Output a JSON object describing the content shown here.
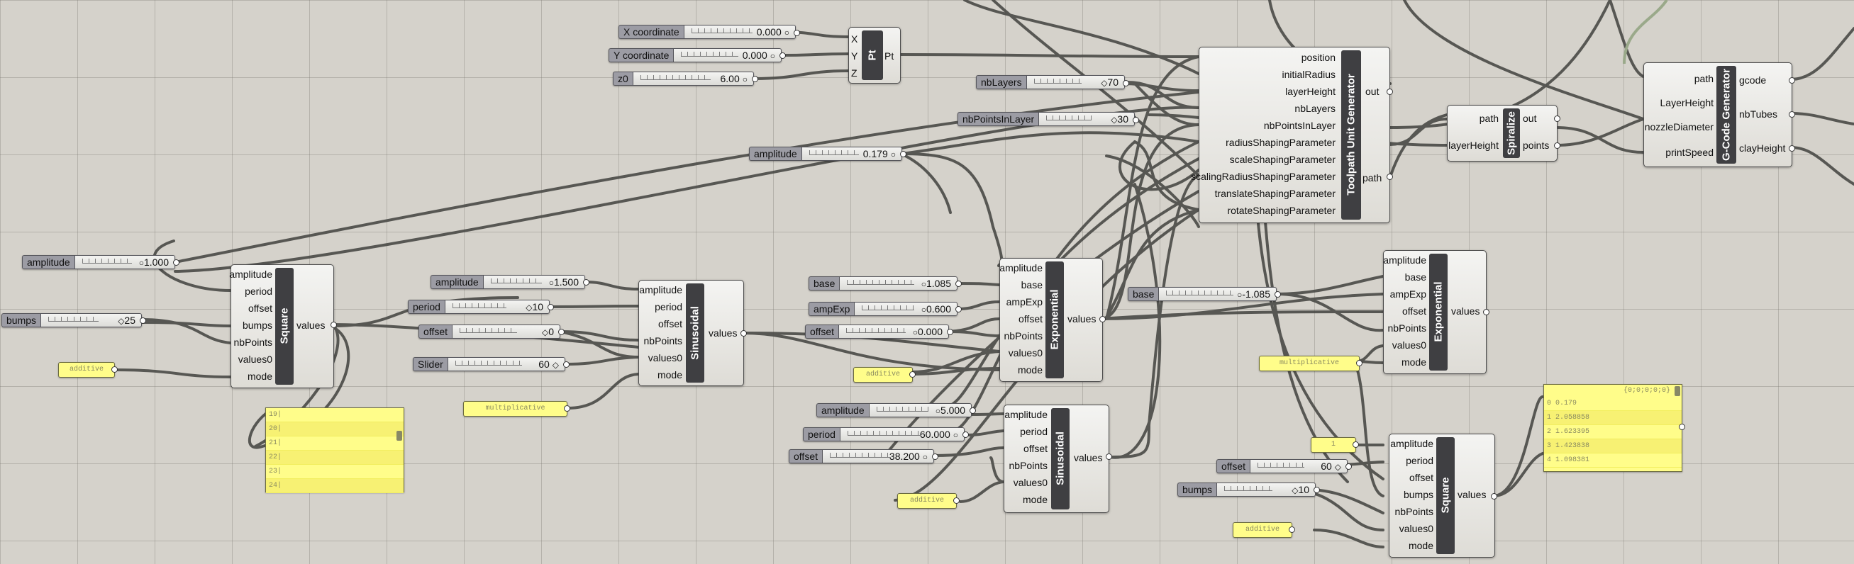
{
  "sliders": {
    "x": {
      "label": "X coordinate",
      "value": "0.000"
    },
    "y": {
      "label": "Y coordinate",
      "value": "0.000"
    },
    "z": {
      "label": "z0",
      "value": "6.00"
    },
    "nbLayers": {
      "label": "nbLayers",
      "value": "70"
    },
    "nbPoints": {
      "label": "nbPointsInLayer",
      "value": "30"
    },
    "ampTop": {
      "label": "amplitude",
      "value": "0.179"
    },
    "sqAmp": {
      "label": "amplitude",
      "value": "1.000"
    },
    "sqBumps": {
      "label": "bumps",
      "value": "25"
    },
    "sinAmp": {
      "label": "amplitude",
      "value": "1.500"
    },
    "sinPeriod": {
      "label": "period",
      "value": "10"
    },
    "sinOffset": {
      "label": "offset",
      "value": "0"
    },
    "slider60": {
      "label": "Slider",
      "value": "60"
    },
    "expBase": {
      "label": "base",
      "value": "1.085"
    },
    "expAmp": {
      "label": "ampExp",
      "value": "0.600"
    },
    "expOffset": {
      "label": "offset",
      "value": "0.000"
    },
    "exp2Base": {
      "label": "base",
      "value": "-1.085"
    },
    "sin2Amp": {
      "label": "amplitude",
      "value": "5.000"
    },
    "sin2Period": {
      "label": "period",
      "value": "60.000"
    },
    "sin2Offset": {
      "label": "offset",
      "value": "38.200"
    },
    "sq2Offset": {
      "label": "offset",
      "value": "60"
    },
    "sq2Bumps": {
      "label": "bumps",
      "value": "10"
    }
  },
  "components": {
    "pt": {
      "title": "Pt",
      "inputs": [
        "X",
        "Y",
        "Z"
      ],
      "outputs": [
        "Pt"
      ]
    },
    "toolpath": {
      "title": "Toolpath Unit Generator",
      "inputs": [
        "position",
        "initialRadius",
        "layerHeight",
        "nbLayers",
        "nbPointsInLayer",
        "radiusShapingParameter",
        "scaleShapingParameter",
        "scalingRadiusShapingParameter",
        "translateShapingParameter",
        "rotateShapingParameter"
      ],
      "outputs": [
        "out",
        "path"
      ]
    },
    "spiralize": {
      "title": "Spiralize",
      "inputs": [
        "path",
        "layerHeight"
      ],
      "outputs": [
        "out",
        "points"
      ]
    },
    "gcode": {
      "title": "G-Code Generator",
      "inputs": [
        "path",
        "LayerHeight",
        "nozzleDiameter",
        "printSpeed"
      ],
      "outputs": [
        "gcode",
        "nbTubes",
        "clayHeight"
      ]
    },
    "square1": {
      "title": "Square",
      "inputs": [
        "amplitude",
        "period",
        "offset",
        "bumps",
        "nbPoints",
        "values0",
        "mode"
      ],
      "outputs": [
        "values"
      ]
    },
    "sinus1": {
      "title": "Sinusoidal",
      "inputs": [
        "amplitude",
        "period",
        "offset",
        "nbPoints",
        "values0",
        "mode"
      ],
      "outputs": [
        "values"
      ]
    },
    "exp1": {
      "title": "Exponential",
      "inputs": [
        "amplitude",
        "base",
        "ampExp",
        "offset",
        "nbPoints",
        "values0",
        "mode"
      ],
      "outputs": [
        "values"
      ]
    },
    "exp2": {
      "title": "Exponential",
      "inputs": [
        "amplitude",
        "base",
        "ampExp",
        "offset",
        "nbPoints",
        "values0",
        "mode"
      ],
      "outputs": [
        "values"
      ]
    },
    "sinus2": {
      "title": "Sinusoidal",
      "inputs": [
        "amplitude",
        "period",
        "offset",
        "nbPoints",
        "values0",
        "mode"
      ],
      "outputs": [
        "values"
      ]
    },
    "square2": {
      "title": "Square",
      "inputs": [
        "amplitude",
        "period",
        "offset",
        "bumps",
        "nbPoints",
        "values0",
        "mode"
      ],
      "outputs": [
        "values"
      ]
    }
  },
  "panels": {
    "add1": "additive",
    "mult1": "multiplicative",
    "add2": "additive",
    "add3": "additive",
    "mult2": "multiplicative",
    "one": "1",
    "add4": "additive",
    "list1": [
      "19|",
      "20|",
      "21|",
      "22|",
      "23|",
      "24|"
    ],
    "list2": {
      "header": "{0;0;0;0;0}",
      "rows": [
        "0 0.179",
        "1 2.058858",
        "2 1.623395",
        "3 1.423838",
        "4 1.098381"
      ]
    }
  },
  "icons": {
    "knob": "○",
    "diamond": "◇"
  }
}
